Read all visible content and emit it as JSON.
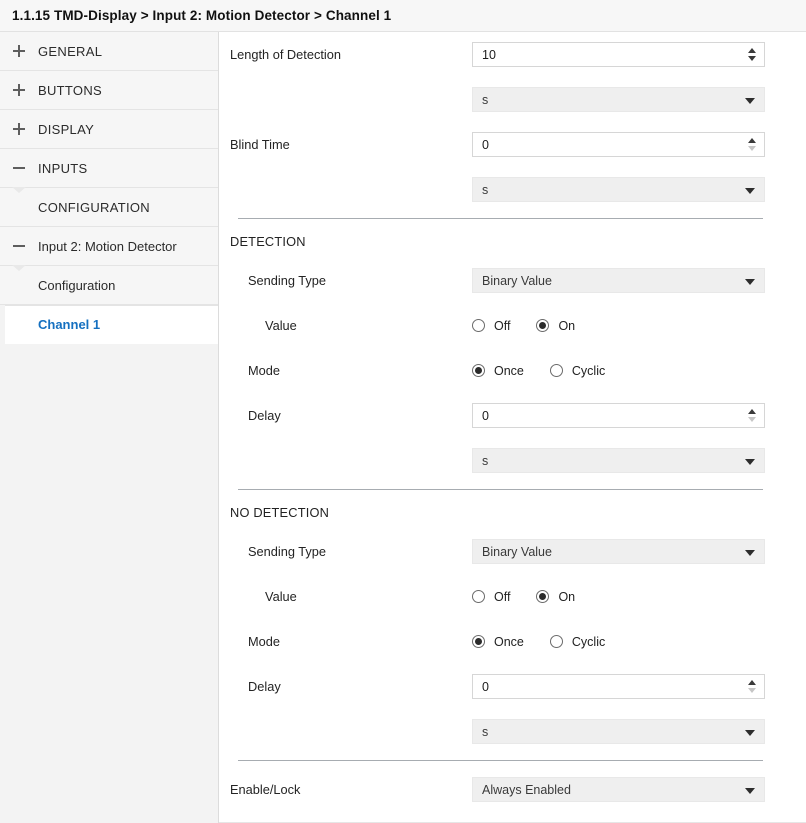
{
  "header": {
    "breadcrumb": "1.1.15 TMD-Display > Input 2: Motion Detector > Channel 1"
  },
  "sidebar": {
    "items": [
      {
        "label": "GENERAL",
        "toggle": "plus",
        "level": 0,
        "selected": false
      },
      {
        "label": "BUTTONS",
        "toggle": "plus",
        "level": 0,
        "selected": false
      },
      {
        "label": "DISPLAY",
        "toggle": "plus",
        "level": 0,
        "selected": false
      },
      {
        "label": "INPUTS",
        "toggle": "minus",
        "level": 0,
        "selected": false
      },
      {
        "label": "CONFIGURATION",
        "toggle": "none",
        "level": 1,
        "selected": false
      },
      {
        "label": "Input 2: Motion Detector",
        "toggle": "minus",
        "level": 0,
        "selected": false
      },
      {
        "label": "Configuration",
        "toggle": "none",
        "level": 2,
        "selected": false
      },
      {
        "label": "Channel 1",
        "toggle": "none",
        "level": 2,
        "selected": true
      }
    ],
    "selected_color": "#1570c0"
  },
  "form": {
    "length_of_detection": {
      "label": "Length of Detection",
      "value": "10",
      "unit": "s"
    },
    "blind_time": {
      "label": "Blind Time",
      "value": "0",
      "unit": "s"
    },
    "detection": {
      "title": "DETECTION",
      "sending_type": {
        "label": "Sending Type",
        "value": "Binary Value"
      },
      "value_row": {
        "label": "Value",
        "options": [
          "Off",
          "On"
        ],
        "selected": "On"
      },
      "mode_row": {
        "label": "Mode",
        "options": [
          "Once",
          "Cyclic"
        ],
        "selected": "Once"
      },
      "delay": {
        "label": "Delay",
        "value": "0",
        "unit": "s"
      }
    },
    "no_detection": {
      "title": "NO DETECTION",
      "sending_type": {
        "label": "Sending Type",
        "value": "Binary Value"
      },
      "value_row": {
        "label": "Value",
        "options": [
          "Off",
          "On"
        ],
        "selected": "On"
      },
      "mode_row": {
        "label": "Mode",
        "options": [
          "Once",
          "Cyclic"
        ],
        "selected": "Once"
      },
      "delay": {
        "label": "Delay",
        "value": "0",
        "unit": "s"
      }
    },
    "enable_lock": {
      "label": "Enable/Lock",
      "value": "Always Enabled"
    }
  }
}
